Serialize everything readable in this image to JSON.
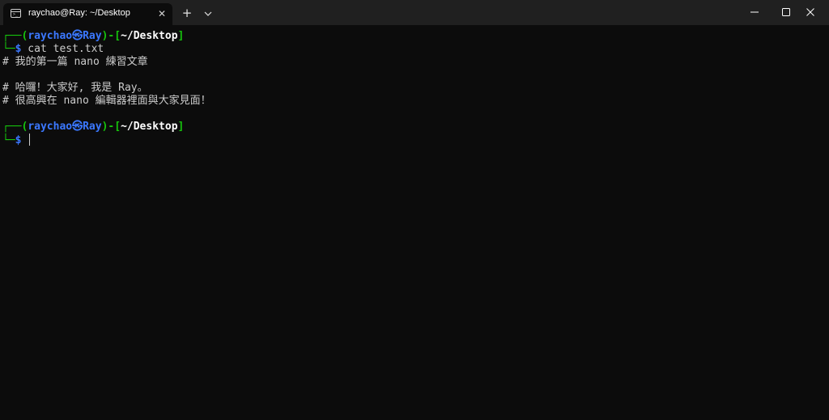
{
  "window": {
    "tab_title": "raychao@Ray: ~/Desktop",
    "tab_close": "✕",
    "new_tab": "+"
  },
  "colors": {
    "prompt_frame": "#16c60c",
    "prompt_user": "#3b78ff",
    "text": "#cccccc",
    "background": "#0c0c0c"
  },
  "terminal": {
    "prompt1": {
      "frame_top": "┌──(",
      "user_host": "raychao㉿Ray",
      "mid": ")-[",
      "path": "~/Desktop",
      "end": "]",
      "frame_bottom": "└─",
      "dollar": "$",
      "command": " cat test.txt"
    },
    "output": [
      "# 我的第一篇 nano 練習文章",
      "",
      "# 哈囉！大家好, 我是 Ray。",
      "# 很高興在 nano 編輯器裡面與大家見面！"
    ],
    "prompt2": {
      "frame_top": "┌──(",
      "user_host": "raychao㉿Ray",
      "mid": ")-[",
      "path": "~/Desktop",
      "end": "]",
      "frame_bottom": "└─",
      "dollar": "$",
      "command": " "
    }
  }
}
